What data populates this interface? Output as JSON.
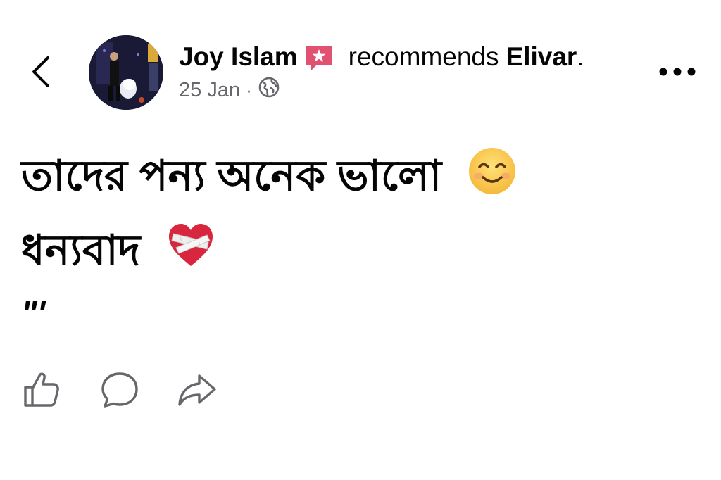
{
  "header": {
    "author_name": "Joy Islam",
    "recommends_text": "recommends",
    "page_name": "Elivar",
    "period": ".",
    "date": "25 Jan",
    "separator": "·",
    "privacy_icon": "globe-icon"
  },
  "post": {
    "line1": "তাদের পন্য অনেক ভালো",
    "line1_emoji": "smiling-face-with-smiling-eyes",
    "line2": "ধন্যবাদ",
    "line2_emoji": "mending-heart",
    "line3": "\"'"
  },
  "icons": {
    "back": "chevron-left-icon",
    "recommend_badge": "recommend-star-icon",
    "more": "more-options-icon",
    "like": "thumbs-up-icon",
    "comment": "comment-icon",
    "share": "share-icon"
  },
  "colors": {
    "text_primary": "#050505",
    "text_secondary": "#65676b",
    "recommend_badge": "#e0526f",
    "icon_gray": "#65676b"
  }
}
